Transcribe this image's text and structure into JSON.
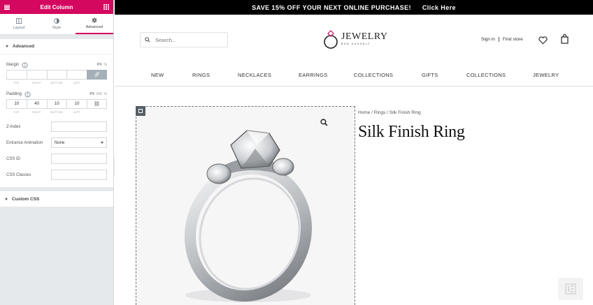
{
  "panel": {
    "title": "Edit Column",
    "tabs": [
      {
        "label": "Layout",
        "icon": "layout-icon"
      },
      {
        "label": "Style",
        "icon": "style-icon"
      },
      {
        "label": "Advanced",
        "icon": "gear-icon",
        "active": true
      }
    ],
    "advanced": {
      "section_title": "Advanced",
      "margin": {
        "label": "Margin",
        "units": [
          "PX",
          "%"
        ],
        "values": [
          "",
          "",
          "",
          ""
        ],
        "sublabels": [
          "TOP",
          "RIGHT",
          "BOTTOM",
          "LEFT"
        ]
      },
      "padding": {
        "label": "Padding",
        "units": [
          "PX",
          "EM",
          "%"
        ],
        "values": [
          "10",
          "40",
          "10",
          "10"
        ],
        "sublabels": [
          "TOP",
          "RIGHT",
          "BOTTOM",
          "LEFT"
        ]
      },
      "z_index": {
        "label": "Z-Index",
        "value": ""
      },
      "entrance_animation": {
        "label": "Entrance Animation",
        "value": "None"
      },
      "css_id": {
        "label": "CSS ID",
        "value": ""
      },
      "css_classes": {
        "label": "CSS Classes",
        "value": ""
      }
    },
    "custom_css": {
      "section_title": "Custom CSS"
    }
  },
  "site": {
    "promo": {
      "text": "SAVE 15% OFF YOUR NEXT ONLINE PURCHASE!",
      "cta": "Click Here"
    },
    "search_placeholder": "Search...",
    "logo": {
      "main": "JEWELRY",
      "sub": "BOB KASHALY"
    },
    "account": {
      "sign_in": "Sign in",
      "find_store": "Find store"
    },
    "nav": [
      "NEW",
      "RINGS",
      "NECKLACES",
      "EARRINGS",
      "COLLECTIONS",
      "GIFTS",
      "COLLECTIONS",
      "JEWELRY"
    ],
    "product": {
      "breadcrumb": "Home / Rings / Silk Finish Ring",
      "title": "Silk Finish Ring"
    }
  },
  "colors": {
    "accent": "#d5085f",
    "promo_bg": "#000000"
  }
}
